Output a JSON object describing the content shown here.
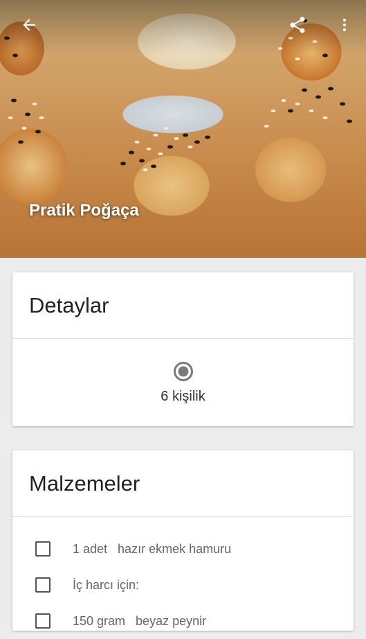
{
  "recipe": {
    "title": "Pratik Poğaça"
  },
  "toolbar": {
    "back_icon": "arrow-back-icon",
    "share_icon": "share-icon",
    "more_icon": "more-vert-icon"
  },
  "details": {
    "header": "Detaylar",
    "servings_icon": "radio-target-icon",
    "servings": "6 kişilik"
  },
  "ingredients": {
    "header": "Malzemeler",
    "items": [
      {
        "label": "1 adet   hazır ekmek hamuru"
      },
      {
        "label": "İç harcı için:"
      },
      {
        "label": "150 gram   beyaz peynir"
      }
    ]
  },
  "colors": {
    "background": "#ececec",
    "card": "#ffffff",
    "text_primary": "#222222",
    "text_secondary": "#666666"
  }
}
